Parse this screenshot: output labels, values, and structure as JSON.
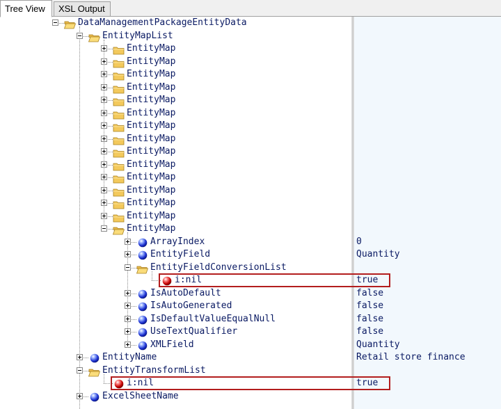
{
  "tabs": [
    {
      "label": "Tree View",
      "active": true
    },
    {
      "label": "XSL Output",
      "active": false
    }
  ],
  "colors": {
    "label_text": "#0a1a63",
    "highlight_border": "#b31d1d",
    "value_column_bg": "#f2f8fd"
  },
  "tree": [
    {
      "label": "DataManagementPackageEntityData",
      "icon": "folder-open",
      "level": 0,
      "expander": "minus"
    },
    {
      "label": "EntityMapList",
      "icon": "folder-open",
      "level": 1,
      "expander": "minus"
    },
    {
      "label": "EntityMap",
      "icon": "folder",
      "level": 2,
      "expander": "plus"
    },
    {
      "label": "EntityMap",
      "icon": "folder",
      "level": 2,
      "expander": "plus"
    },
    {
      "label": "EntityMap",
      "icon": "folder",
      "level": 2,
      "expander": "plus"
    },
    {
      "label": "EntityMap",
      "icon": "folder",
      "level": 2,
      "expander": "plus"
    },
    {
      "label": "EntityMap",
      "icon": "folder",
      "level": 2,
      "expander": "plus"
    },
    {
      "label": "EntityMap",
      "icon": "folder",
      "level": 2,
      "expander": "plus"
    },
    {
      "label": "EntityMap",
      "icon": "folder",
      "level": 2,
      "expander": "plus"
    },
    {
      "label": "EntityMap",
      "icon": "folder",
      "level": 2,
      "expander": "plus"
    },
    {
      "label": "EntityMap",
      "icon": "folder",
      "level": 2,
      "expander": "plus"
    },
    {
      "label": "EntityMap",
      "icon": "folder",
      "level": 2,
      "expander": "plus"
    },
    {
      "label": "EntityMap",
      "icon": "folder",
      "level": 2,
      "expander": "plus"
    },
    {
      "label": "EntityMap",
      "icon": "folder",
      "level": 2,
      "expander": "plus"
    },
    {
      "label": "EntityMap",
      "icon": "folder",
      "level": 2,
      "expander": "plus"
    },
    {
      "label": "EntityMap",
      "icon": "folder",
      "level": 2,
      "expander": "plus"
    },
    {
      "label": "EntityMap",
      "icon": "folder-open",
      "level": 2,
      "expander": "minus"
    },
    {
      "label": "ArrayIndex",
      "icon": "blue-ball",
      "level": 3,
      "expander": "plus",
      "value": "0"
    },
    {
      "label": "EntityField",
      "icon": "blue-ball",
      "level": 3,
      "expander": "plus",
      "value": "Quantity"
    },
    {
      "label": "EntityFieldConversionList",
      "icon": "folder-open",
      "level": 3,
      "expander": "minus"
    },
    {
      "label": "i:nil",
      "icon": "red-ball",
      "level": 4,
      "expander": "none",
      "value": "true",
      "highlight": true
    },
    {
      "label": "IsAutoDefault",
      "icon": "blue-ball",
      "level": 3,
      "expander": "plus",
      "value": "false"
    },
    {
      "label": "IsAutoGenerated",
      "icon": "blue-ball",
      "level": 3,
      "expander": "plus",
      "value": "false"
    },
    {
      "label": "IsDefaultValueEqualNull",
      "icon": "blue-ball",
      "level": 3,
      "expander": "plus",
      "value": "false"
    },
    {
      "label": "UseTextQualifier",
      "icon": "blue-ball",
      "level": 3,
      "expander": "plus",
      "value": "false"
    },
    {
      "label": "XMLField",
      "icon": "blue-ball",
      "level": 3,
      "expander": "plus",
      "value": "Quantity"
    },
    {
      "label": "EntityName",
      "icon": "blue-ball",
      "level": 1,
      "expander": "plus",
      "value": "Retail store finance"
    },
    {
      "label": "EntityTransformList",
      "icon": "folder-open",
      "level": 1,
      "expander": "minus"
    },
    {
      "label": "i:nil",
      "icon": "red-ball",
      "level": 2,
      "expander": "none",
      "value": "true",
      "highlight": true
    },
    {
      "label": "ExcelSheetName",
      "icon": "blue-ball",
      "level": 1,
      "expander": "plus"
    }
  ]
}
